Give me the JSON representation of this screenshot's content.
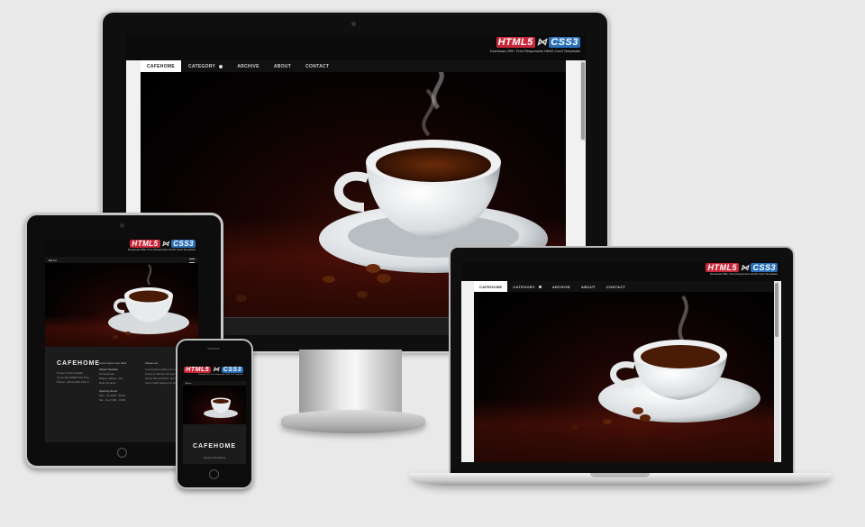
{
  "logo": {
    "html5": "HTML5",
    "css3": "CSS3",
    "tagline": "Download 299+ Free Responsive Html5 Css3 Templates"
  },
  "nav": {
    "items": [
      "CAFEHOME",
      "CATEGORY",
      "ARCHIVE",
      "ABOUT",
      "CONTACT"
    ],
    "active": "CAFEHOME"
  },
  "mobile_nav": {
    "label": "Menu"
  },
  "tablet_footer": {
    "brand": "CAFEHOME",
    "address": [
      "Tempor 1234 Vestibul",
      "Commodo 90800 City Free",
      "Phone: +63 (0) 000-1111-0"
    ],
    "col2_head": "Lorem ipsum nec dolor",
    "col2_lines": [
      "Aliquet Sodales",
      "consectetuer",
      "aliquet, aliquet, orci.",
      "Dolor sit amet"
    ],
    "hours_head": "Opening Hours",
    "hours": [
      "Mon - Fri 8:00 - 20:00",
      "Sat - Sun 9:00 - 18:00"
    ],
    "col3_head": "Aliquet est",
    "col3_lines": [
      "Lorem ipsum dolor sit amet",
      "luctus et Ultrices elit eget",
      "auctor Nisl tincidunt, quisque",
      "nunc mollis sapien nisi blandit"
    ]
  },
  "phone_footer": {
    "brand": "CAFEHOME",
    "line": "Tempor 1234 Vestibul"
  },
  "colors": {
    "logo_red": "#c8283a",
    "logo_blue": "#2a6fb8",
    "page_bg": "#e9e9e9"
  }
}
